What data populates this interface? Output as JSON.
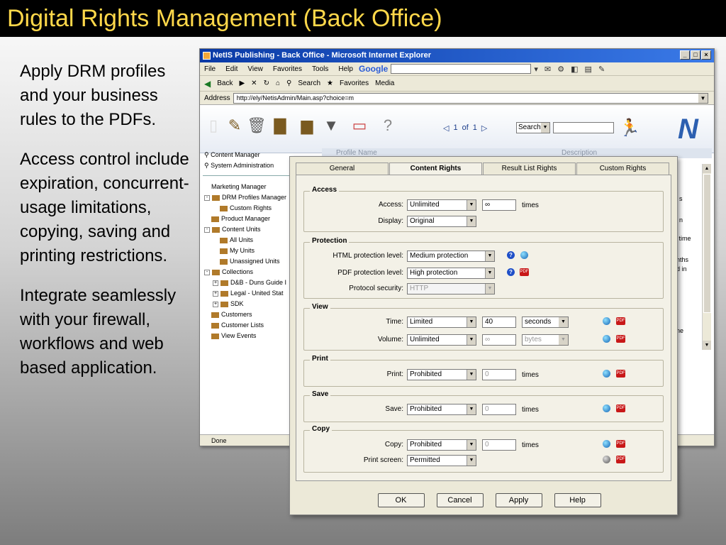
{
  "slide": {
    "title": "Digital Rights Management (Back Office)",
    "bullets": [
      "Apply DRM profiles and your business rules to the PDFs.",
      "Access control include expiration, concurrent-usage limitations, copying, saving and printing restrictions.",
      "Integrate seamlessly with your firewall, workflows and web based application."
    ]
  },
  "browser": {
    "title": "NetIS Publishing - Back Office - Microsoft Internet Explorer",
    "window_buttons": [
      "_",
      "□",
      "×"
    ],
    "menu": [
      "File",
      "Edit",
      "View",
      "Favorites",
      "Tools",
      "Help"
    ],
    "google": "Google",
    "toolbar": [
      "Back",
      "Search",
      "Favorites",
      "Media"
    ],
    "address_label": "Address",
    "address": "http://ely/NetisAdmin/Main.asp?choice=m",
    "status": "Done"
  },
  "app": {
    "pager": {
      "current": "1",
      "of": "of",
      "total": "1"
    },
    "search_label": "Search",
    "left_top": [
      "Content Manager",
      "System Administration"
    ],
    "tree": [
      {
        "label": "Marketing Manager",
        "indent": 0,
        "pm": "",
        "folder": false
      },
      {
        "label": "DRM Profiles Manager",
        "indent": 0,
        "pm": "-",
        "folder": true
      },
      {
        "label": "Custom Rights",
        "indent": 1,
        "pm": "",
        "folder": true
      },
      {
        "label": "Product Manager",
        "indent": 0,
        "pm": "",
        "folder": true
      },
      {
        "label": "Content Units",
        "indent": 0,
        "pm": "-",
        "folder": true
      },
      {
        "label": "All Units",
        "indent": 1,
        "pm": "",
        "folder": true
      },
      {
        "label": "My Units",
        "indent": 1,
        "pm": "",
        "folder": true
      },
      {
        "label": "Unassigned Units",
        "indent": 1,
        "pm": "",
        "folder": true
      },
      {
        "label": "Collections",
        "indent": 0,
        "pm": "-",
        "folder": true
      },
      {
        "label": "D&B - Duns Guide I",
        "indent": 1,
        "pm": "+",
        "folder": true
      },
      {
        "label": "Legal - United Stat",
        "indent": 1,
        "pm": "+",
        "folder": true
      },
      {
        "label": "SDK",
        "indent": 1,
        "pm": "+",
        "folder": true
      },
      {
        "label": "Customers",
        "indent": 0,
        "pm": "",
        "folder": true
      },
      {
        "label": "Customer Lists",
        "indent": 0,
        "pm": "",
        "folder": true
      },
      {
        "label": "View Events",
        "indent": 0,
        "pm": "",
        "folder": true
      }
    ],
    "list_headers": [
      "Profile Name",
      "Description"
    ],
    "right_fragments": [
      "s",
      "n",
      "d time",
      "nths",
      "d in",
      "ne"
    ]
  },
  "dialog": {
    "tabs": [
      "General",
      "Content Rights",
      "Result List Rights",
      "Custom Rights"
    ],
    "active_tab": 1,
    "access": {
      "title": "Access",
      "access_label": "Access:",
      "access_value": "Unlimited",
      "access_count": "∞",
      "times": "times",
      "display_label": "Display:",
      "display_value": "Original"
    },
    "protection": {
      "title": "Protection",
      "html_label": "HTML protection level:",
      "html_value": "Medium protection",
      "pdf_label": "PDF protection level:",
      "pdf_value": "High protection",
      "protocol_label": "Protocol security:",
      "protocol_value": "HTTP"
    },
    "view": {
      "title": "View",
      "time_label": "Time:",
      "time_value": "Limited",
      "time_count": "40",
      "time_unit": "seconds",
      "volume_label": "Volume:",
      "volume_value": "Unlimited",
      "volume_count": "∞",
      "volume_unit": "bytes"
    },
    "print": {
      "title": "Print",
      "label": "Print:",
      "value": "Prohibited",
      "count": "0",
      "times": "times"
    },
    "save": {
      "title": "Save",
      "label": "Save:",
      "value": "Prohibited",
      "count": "0",
      "times": "times"
    },
    "copy": {
      "title": "Copy",
      "label": "Copy:",
      "value": "Prohibited",
      "count": "0",
      "times": "times",
      "screen_label": "Print screen:",
      "screen_value": "Permitted"
    },
    "buttons": {
      "ok": "OK",
      "cancel": "Cancel",
      "apply": "Apply",
      "help": "Help"
    }
  }
}
